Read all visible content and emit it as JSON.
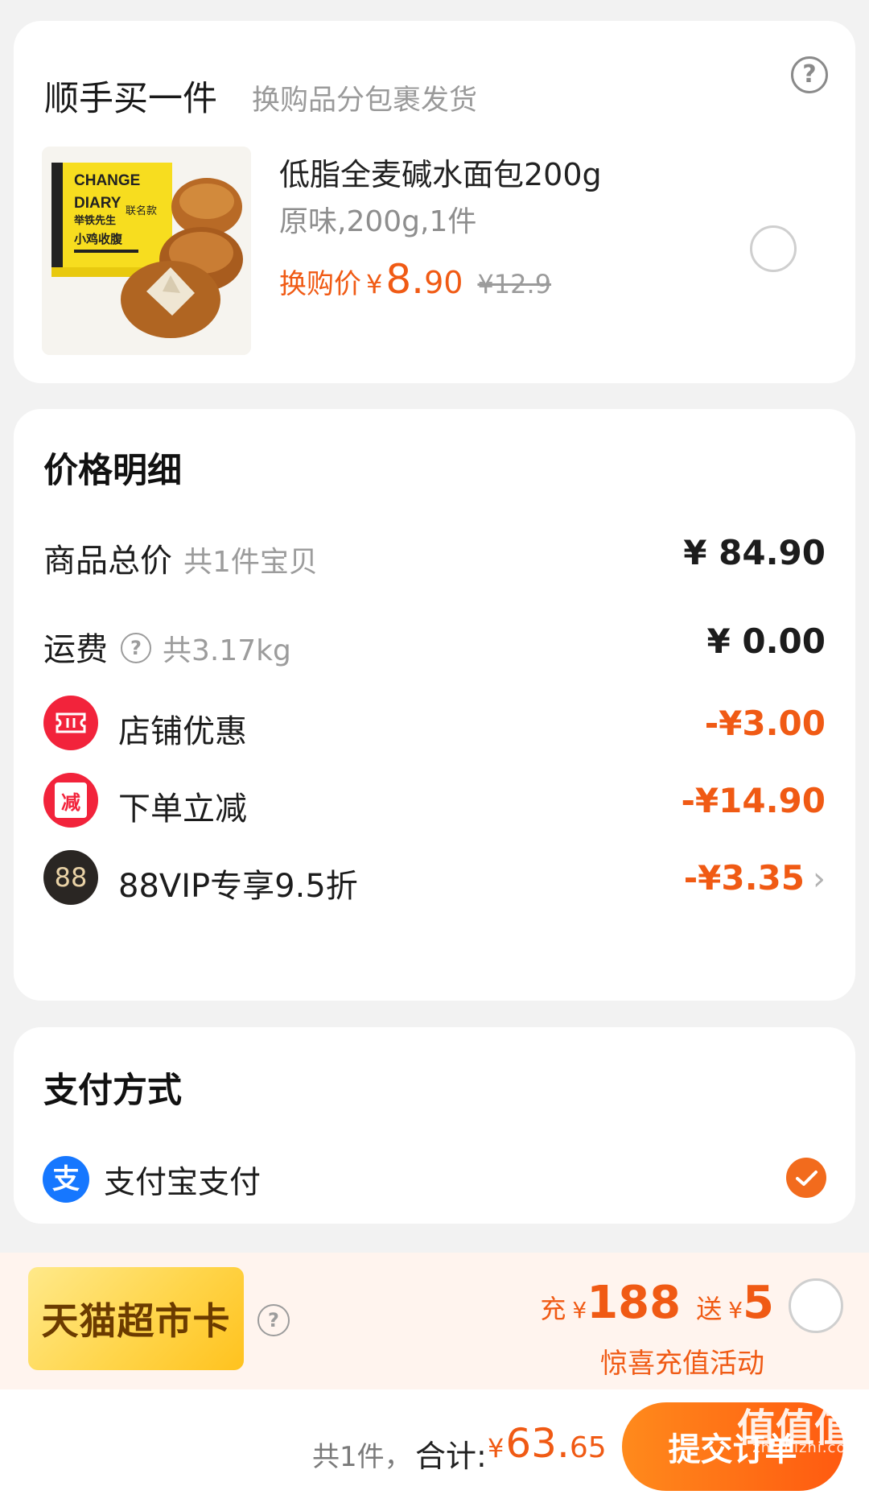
{
  "addon": {
    "title": "顺手买一件",
    "subtitle": "换购品分包裹发货",
    "help_icon": "question-circle-icon",
    "product": {
      "image_alt": "CHANGE DIARY 小鸡收腹 bread package",
      "brand_top": "CHANGE",
      "brand_bottom": "DIARY",
      "collab": "联名款",
      "collab_sub": "举铁先生",
      "package_text": "小鸡收腹",
      "name": "低脂全麦碱水面包200g",
      "spec": "原味,200g,1件",
      "exchange_label": "换购价",
      "yen": "¥",
      "price_int": "8.",
      "price_dec": "90",
      "original_price": "¥12.9",
      "selected": false
    }
  },
  "price_detail": {
    "title": "价格明细",
    "rows": [
      {
        "label": "商品总价",
        "note": "共1件宝贝",
        "value": "¥ 84.90"
      },
      {
        "label": "运费",
        "note": "共3.17kg",
        "value": "¥ 0.00"
      }
    ],
    "discounts": [
      {
        "icon": "ticket-icon",
        "icon_color": "#f2233b",
        "label": "店铺优惠",
        "value": "-¥3.00"
      },
      {
        "icon": "reduce-badge-icon",
        "icon_color": "#f2233b",
        "icon_text": "减",
        "label": "下单立减",
        "value": "-¥14.90"
      },
      {
        "icon": "vip88-icon",
        "icon_color": "#2a2623",
        "icon_text": "88",
        "label": "88VIP专享9.5折",
        "value": "-¥3.35"
      }
    ]
  },
  "payment": {
    "title": "支付方式",
    "method_icon": "alipay-icon",
    "method_icon_text": "支",
    "method_label": "支付宝支付",
    "selected": true
  },
  "promo": {
    "card_label": "天猫超市卡",
    "charge_label": "充",
    "charge_yen": "¥",
    "charge_amount": "188",
    "gift_label": "送",
    "gift_yen": "¥",
    "gift_amount": "5",
    "subtitle": "惊喜充值活动",
    "selected": false
  },
  "bottom_bar": {
    "count_text": "共1件，",
    "total_label": "合计:",
    "total_yen": "¥",
    "total_int": "63.",
    "total_dec": "65",
    "submit_label": "提交订单",
    "watermark": "zhizhizhi.com",
    "watermark_badge": "值值值"
  },
  "colors": {
    "accent": "#f05a14",
    "alipay": "#1677ff",
    "check": "#f26b1d",
    "background": "#f2f2f2"
  }
}
